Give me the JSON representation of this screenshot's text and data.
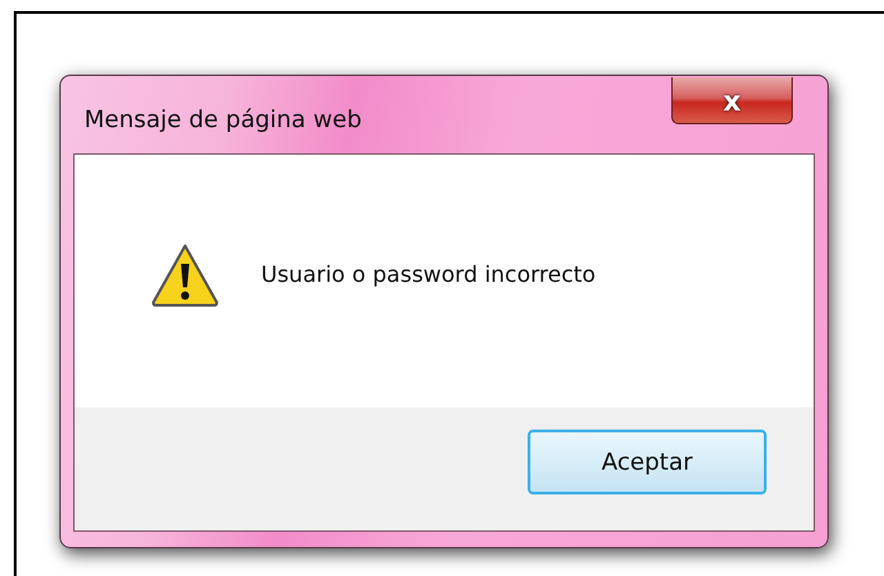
{
  "window": {
    "title": "Mensaje de página web",
    "close_label": "x"
  },
  "message": "Usuario o password incorrecto",
  "buttons": [
    {
      "label": "Aceptar",
      "selected": true
    }
  ]
}
